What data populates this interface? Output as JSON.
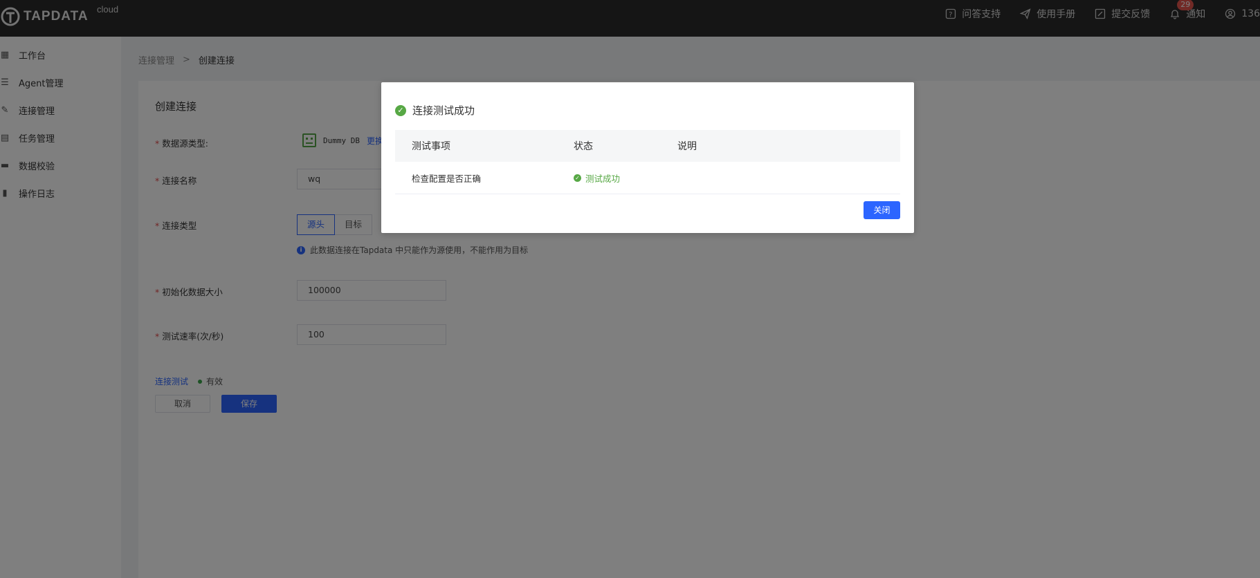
{
  "topbar": {
    "logo_text": "TAPDATA",
    "logo_suffix": "cloud",
    "menu": [
      {
        "icon": "help-icon",
        "label": "问答支持"
      },
      {
        "icon": "paper-plane-icon",
        "label": "使用手册"
      },
      {
        "icon": "edit-icon",
        "label": "提交反馈"
      },
      {
        "icon": "bell-icon",
        "label": "通知",
        "badge": "29"
      },
      {
        "icon": "user-icon",
        "label": "136"
      }
    ]
  },
  "sidebar": {
    "items": [
      {
        "icon": "dashboard-icon",
        "label": "工作台"
      },
      {
        "icon": "list-icon",
        "label": "Agent管理"
      },
      {
        "icon": "link-icon",
        "label": "连接管理"
      },
      {
        "icon": "task-icon",
        "label": "任务管理"
      },
      {
        "icon": "verify-icon",
        "label": "数据校验"
      },
      {
        "icon": "log-icon",
        "label": "操作日志"
      }
    ]
  },
  "breadcrumb": {
    "parent": "连接管理",
    "separator": ">",
    "current": "创建连接"
  },
  "form": {
    "title": "创建连接",
    "datasource_label": "数据源类型:",
    "datasource_name": "Dummy DB",
    "datasource_change": "更换",
    "name_label": "连接名称",
    "name_value": "wq",
    "type_label": "连接类型",
    "type_options": [
      "源头",
      "目标"
    ],
    "type_hint": "此数据连接在Tapdata 中只能作为源使用，不能作用为目标",
    "init_size_label": "初始化数据大小",
    "init_size_value": "100000",
    "rate_label": "测试速率(次/秒)",
    "rate_value": "100",
    "test_link": "连接测试",
    "test_status": "有效",
    "cancel_label": "取消",
    "save_label": "保存"
  },
  "dialog": {
    "title": "连接测试成功",
    "columns": [
      "测试事项",
      "状态",
      "说明"
    ],
    "rows": [
      {
        "item": "检查配置是否正确",
        "status": "测试成功",
        "note": ""
      }
    ],
    "close_label": "关闭"
  }
}
